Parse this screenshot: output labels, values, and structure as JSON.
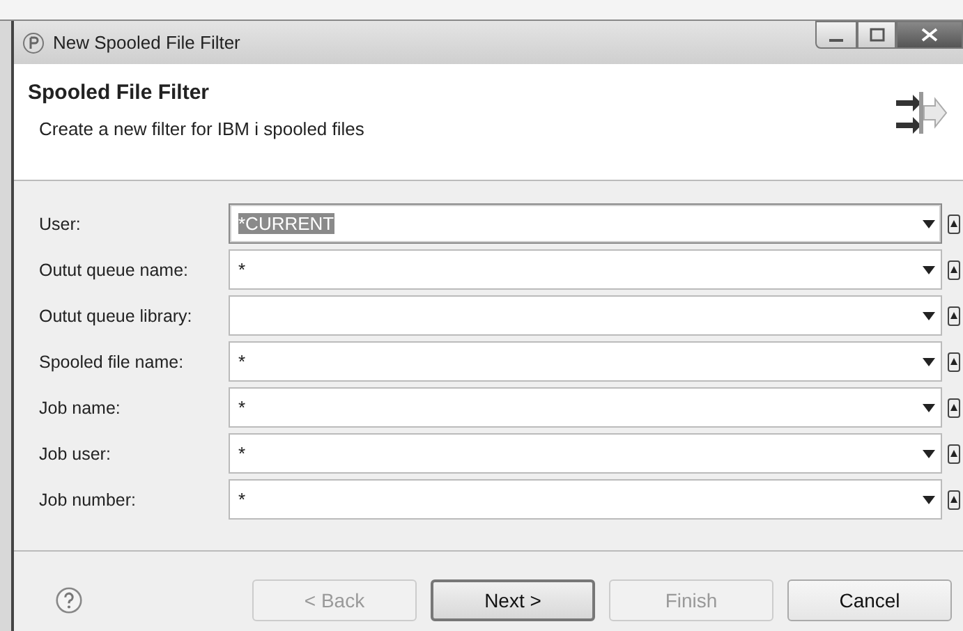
{
  "window": {
    "title": "New Spooled File Filter"
  },
  "header": {
    "title": "Spooled File Filter",
    "description": "Create a new filter for IBM i spooled files"
  },
  "fields": [
    {
      "label": "User:",
      "value": "*CURRENT",
      "highlighted": true
    },
    {
      "label": "Outut queue name:",
      "value": "*",
      "highlighted": false
    },
    {
      "label": "Outut queue library:",
      "highlighted": false
    },
    {
      "label": "Spooled file name:",
      "value": "*",
      "highlighted": false
    },
    {
      "label": "Job name:",
      "value": "*",
      "highlighted": false
    },
    {
      "label": "Job user:",
      "value": "*",
      "highlighted": false
    },
    {
      "label": "Job number:",
      "value": "*",
      "highlighted": false
    }
  ],
  "buttons": [
    {
      "label": "< Back",
      "disabled": true,
      "default": false
    },
    {
      "label": "Next >",
      "disabled": false,
      "default": true
    },
    {
      "label": "Finish",
      "disabled": true,
      "default": false
    },
    {
      "label": "Cancel",
      "disabled": false,
      "default": false
    }
  ]
}
